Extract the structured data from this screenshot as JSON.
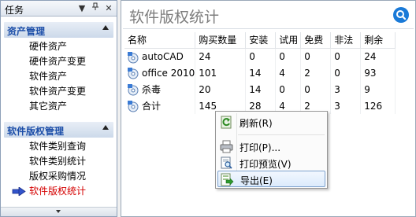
{
  "task_pane": {
    "title": "任务",
    "menu_glyph": "▼",
    "pin_glyph": "ꟷ",
    "close_glyph": "✕",
    "groups": [
      {
        "title": "资产管理",
        "items": [
          "硬件资产",
          "硬件资产变更",
          "软件资产",
          "软件资产变更",
          "其它资产"
        ]
      },
      {
        "title": "软件版权管理",
        "items": [
          "软件类别查询",
          "软件类别统计",
          "版权采购情况",
          "软件版权统计"
        ],
        "active_index": 3
      }
    ],
    "icons": {
      "collapse": "chevron-up-icon",
      "scroll_down": "chevron-down-icon",
      "current": "arrow-right-icon"
    }
  },
  "main": {
    "title": "软件版权统计",
    "search_icon": "search-icon",
    "accent": "#1a7ad8",
    "columns": [
      "名称",
      "购买数量",
      "安装",
      "试用",
      "免费",
      "非法",
      "剩余"
    ],
    "rows": [
      [
        "autoCAD",
        "24",
        "0",
        "0",
        "0",
        "0",
        "24"
      ],
      [
        "office 2010",
        "101",
        "14",
        "4",
        "2",
        "0",
        "93"
      ],
      [
        "杀毒",
        "20",
        "14",
        "0",
        "0",
        "3",
        "9"
      ],
      [
        "合计",
        "145",
        "28",
        "4",
        "2",
        "3",
        "126"
      ]
    ]
  },
  "context_menu": {
    "items": [
      {
        "label": "刷新(R)",
        "icon": "refresh-icon"
      },
      {
        "label": "打印(P)...",
        "icon": "printer-icon"
      },
      {
        "label": "打印预览(V)",
        "icon": "print-preview-icon"
      },
      {
        "label": "导出(E)",
        "icon": "export-icon",
        "highlighted": true
      }
    ]
  }
}
